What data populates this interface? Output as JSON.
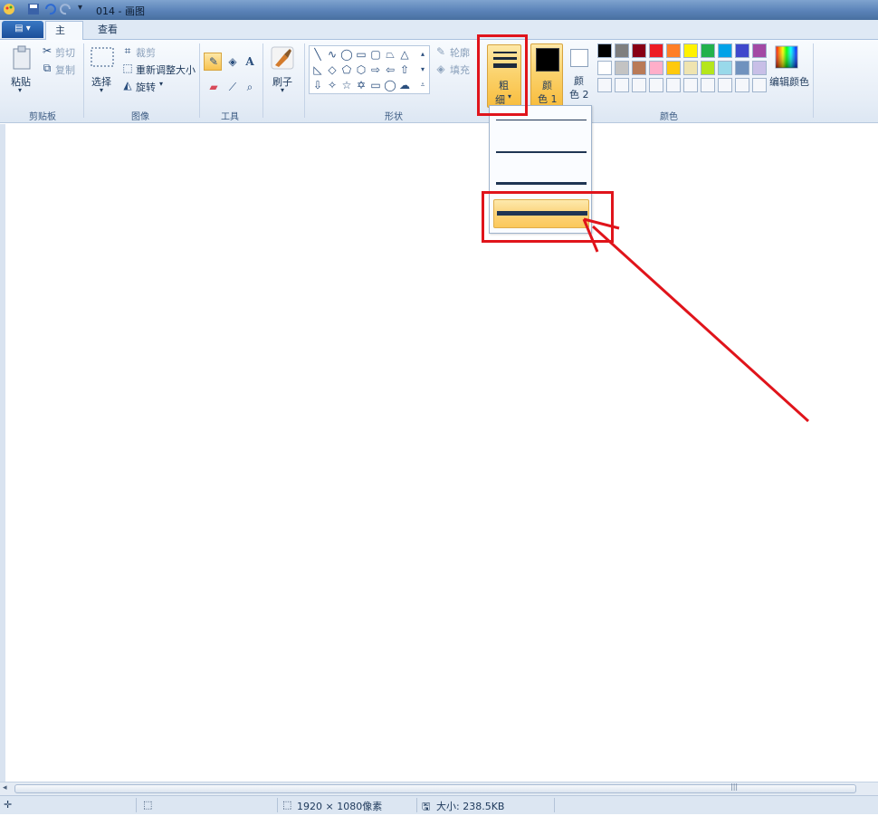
{
  "title": "014 - 画图",
  "tabs": {
    "app_menu": "▤ ▾",
    "home": "主页",
    "view": "查看"
  },
  "clipboard": {
    "paste": "粘贴",
    "cut": "剪切",
    "copy": "复制",
    "group": "剪贴板"
  },
  "image": {
    "select": "选择",
    "crop": "裁剪",
    "resize": "重新调整大小",
    "rotate": "旋转",
    "group": "图像"
  },
  "tools": {
    "group": "工具"
  },
  "brush": {
    "label": "刷子"
  },
  "shapes": {
    "outline": "轮廓",
    "fill": "填充",
    "group": "形状"
  },
  "size": {
    "line1": "粗",
    "line2": "细"
  },
  "colors": {
    "color1_line1": "颜",
    "color1_line2": "色 1",
    "color2_line1": "颜",
    "color2_line2": "色 2",
    "edit": "编辑颜色",
    "group": "颜色",
    "palette_row1": [
      "#000000",
      "#7f7f7f",
      "#880015",
      "#ed1c24",
      "#ff7f27",
      "#fff200",
      "#22b14c",
      "#00a2e8",
      "#3f48cc",
      "#a349a4"
    ],
    "palette_row2": [
      "#ffffff",
      "#c3c3c3",
      "#b97a57",
      "#ffaec9",
      "#ffc90e",
      "#efe4b0",
      "#b5e61d",
      "#99d9ea",
      "#7092be",
      "#c8bfe7"
    ],
    "palette_row3": [
      "#f5f7fb",
      "#f5f7fb",
      "#f5f7fb",
      "#f5f7fb",
      "#f5f7fb",
      "#f5f7fb",
      "#f5f7fb",
      "#f5f7fb",
      "#f5f7fb",
      "#f5f7fb"
    ]
  },
  "status": {
    "dimensions": "1920 × 1080像素",
    "size": "大小: 238.5KB"
  },
  "accent": "#e0141b"
}
